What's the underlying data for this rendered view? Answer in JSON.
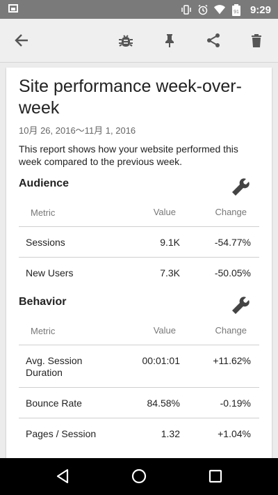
{
  "status_bar": {
    "time": "9:29",
    "battery_level_text": "91"
  },
  "toolbar": {
    "back_icon": "arrow-left-icon",
    "bug_icon": "bug-icon",
    "pin_icon": "pin-icon",
    "share_icon": "share-icon",
    "delete_icon": "trash-icon"
  },
  "report": {
    "title": "Site performance week-over-week",
    "date_range": "10月 26, 2016～11月 1, 2016",
    "description": "This report shows how your website performed this week compared to the previous week."
  },
  "audience": {
    "heading": "Audience",
    "columns": {
      "metric": "Metric",
      "value": "Value",
      "change": "Change"
    },
    "rows": [
      {
        "metric": "Sessions",
        "value": "9.1K",
        "change": "-54.77%"
      },
      {
        "metric": "New Users",
        "value": "7.3K",
        "change": "-50.05%"
      }
    ]
  },
  "behavior": {
    "heading": "Behavior",
    "columns": {
      "metric": "Metric",
      "value": "Value",
      "change": "Change"
    },
    "rows": [
      {
        "metric": "Avg. Session Duration",
        "value": "00:01:01",
        "change": "+11.62%"
      },
      {
        "metric": "Bounce Rate",
        "value": "84.58%",
        "change": "-0.19%"
      },
      {
        "metric": "Pages / Session",
        "value": "1.32",
        "change": "+1.04%"
      }
    ]
  },
  "colors": {
    "status_bar": "#7a7a7a",
    "toolbar": "#efefef",
    "icon": "#555555",
    "nav_bar": "#000000"
  }
}
